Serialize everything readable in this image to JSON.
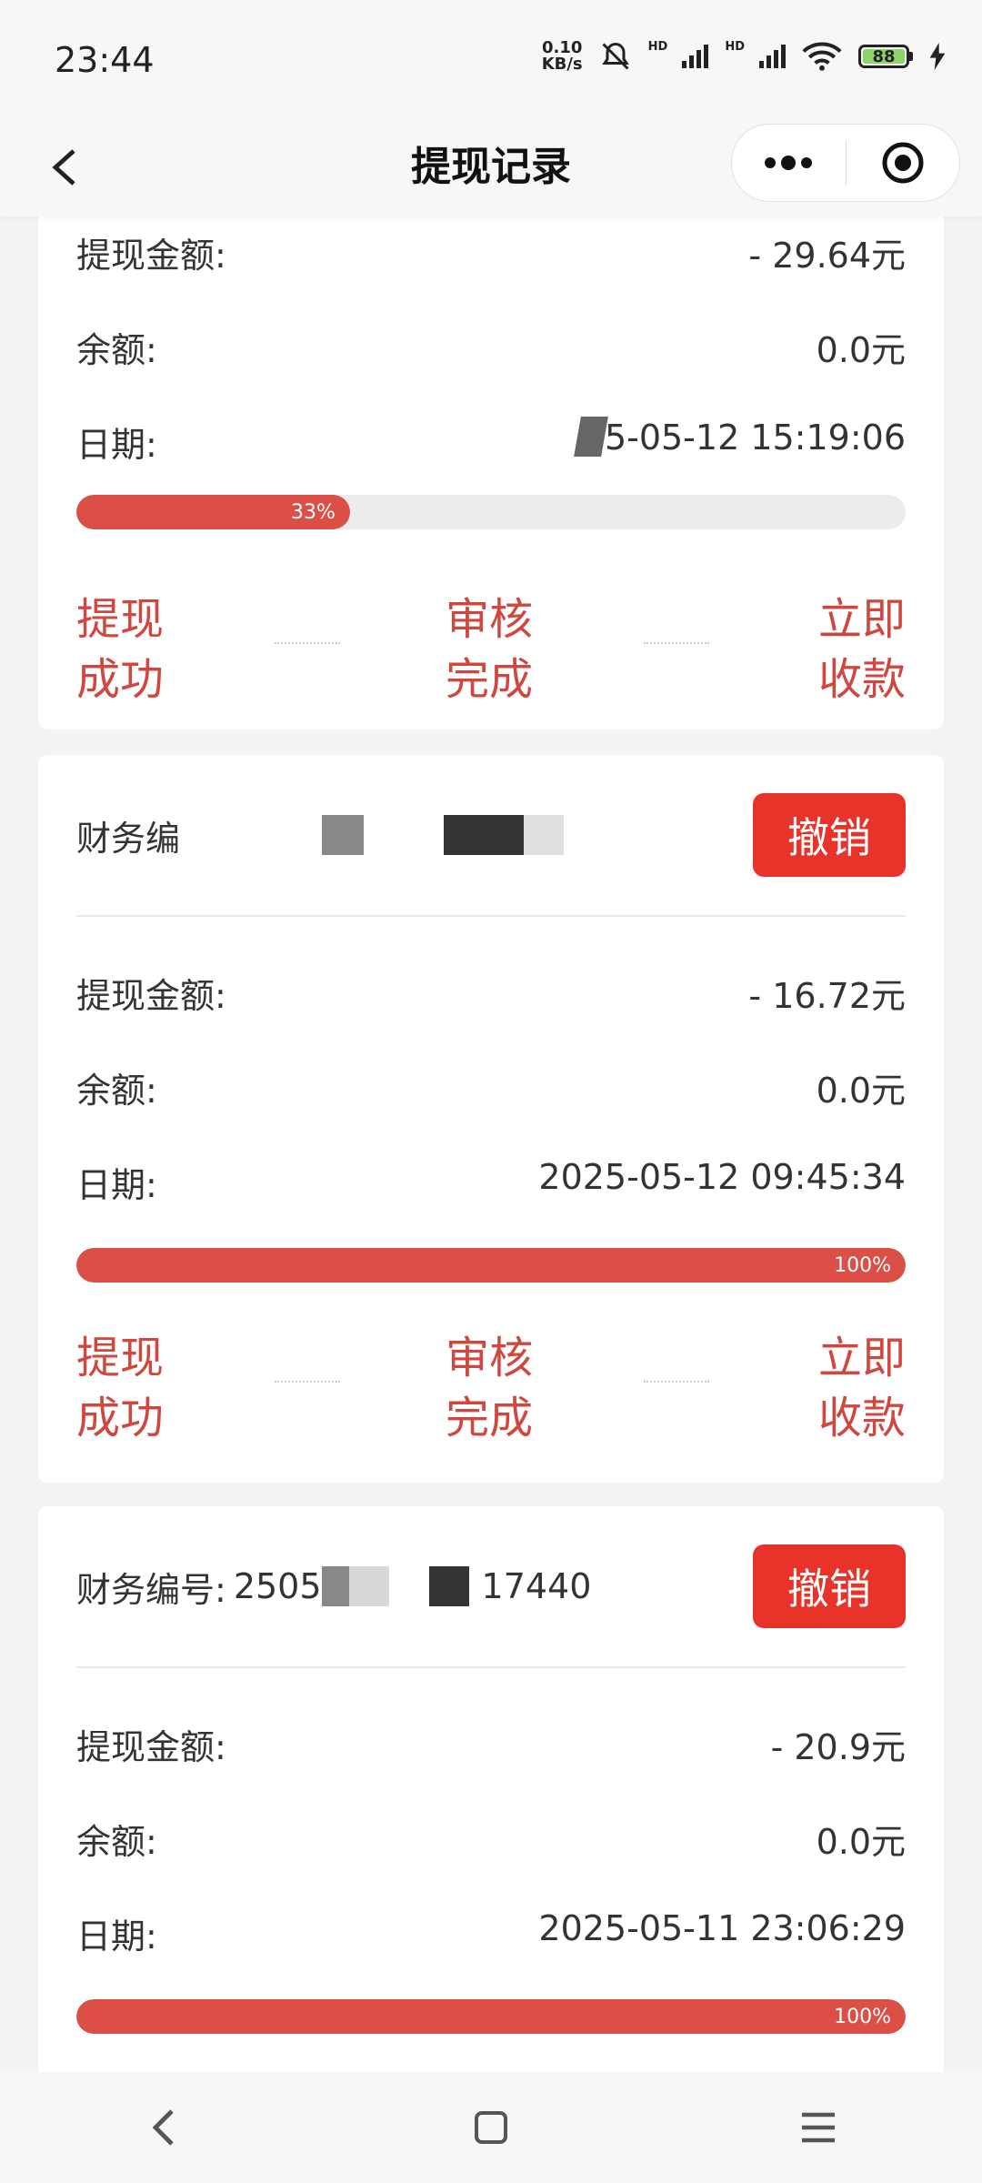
{
  "status_bar": {
    "time": "23:44",
    "net_speed_value": "0.10",
    "net_speed_unit": "KB/s",
    "battery": "88",
    "hd_label": "HD"
  },
  "nav": {
    "title": "提现记录"
  },
  "records": [
    {
      "amount_label": "提现金额:",
      "amount": "- 29.64元",
      "balance_label": "余额:",
      "balance": "0.0元",
      "date_label": "日期:",
      "date": "5-05-12 15:19:06",
      "progress_percent": 33,
      "progress_text": "33%",
      "steps": [
        [
          "提现",
          "成功"
        ],
        [
          "审核",
          "完成"
        ],
        [
          "立即",
          "收款"
        ]
      ]
    },
    {
      "fin_label": "财务编",
      "cancel_label": "撤销",
      "amount_label": "提现金额:",
      "amount": "- 16.72元",
      "balance_label": "余额:",
      "balance": "0.0元",
      "date_label": "日期:",
      "date": "2025-05-12 09:45:34",
      "progress_percent": 100,
      "progress_text": "100%",
      "steps": [
        [
          "提现",
          "成功"
        ],
        [
          "审核",
          "完成"
        ],
        [
          "立即",
          "收款"
        ]
      ]
    },
    {
      "fin_label": "财务编号:",
      "fin_prefix": "2505",
      "fin_suffix": "17440",
      "cancel_label": "撤销",
      "amount_label": "提现金额:",
      "amount": "- 20.9元",
      "balance_label": "余额:",
      "balance": "0.0元",
      "date_label": "日期:",
      "date": "2025-05-11 23:06:29",
      "progress_percent": 100,
      "progress_text": "100%"
    }
  ]
}
